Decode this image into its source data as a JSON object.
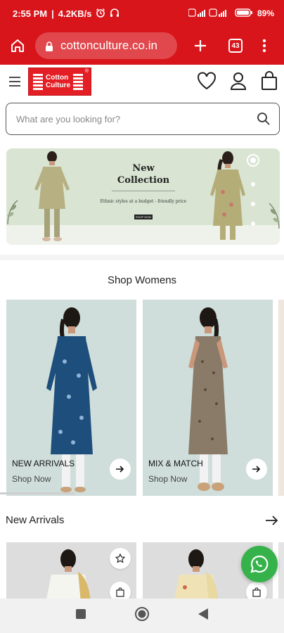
{
  "status_bar": {
    "time": "2:55 PM",
    "speed": "4.2KB/s",
    "battery": "89%",
    "icons": [
      "alarm-icon",
      "headphones-icon",
      "signal-icon",
      "wifi-icon",
      "battery-icon"
    ]
  },
  "browser": {
    "url": "cottonculture.co.in",
    "tab_count": "43",
    "icons": [
      "home-icon",
      "lock-icon",
      "new-tab-icon",
      "tab-switcher-icon",
      "more-menu-icon"
    ]
  },
  "site": {
    "logo_line1": "Cotton",
    "logo_line2": "Culture",
    "logo_mark": "®",
    "search_placeholder": "What are you looking for?",
    "icons": [
      "menu-icon",
      "wishlist-icon",
      "account-icon",
      "cart-icon",
      "search-icon"
    ]
  },
  "banner": {
    "title_line1": "New",
    "title_line2": "Collection",
    "subtitle": "Ethnic styles at a budget - friendly price",
    "button_label": "SHOP NOW",
    "slides": 4,
    "active_slide": 1
  },
  "shop_womens": {
    "title": "Shop Womens",
    "cards": [
      {
        "label": "NEW ARRIVALS",
        "sub": "Shop Now",
        "dress_color": "#1d4e7c"
      },
      {
        "label": "MIX & MATCH",
        "sub": "Shop Now",
        "dress_color": "#8a7a68"
      }
    ]
  },
  "new_arrivals": {
    "title": "New Arrivals"
  },
  "colors": {
    "brand_red": "#d8151b",
    "whatsapp_green": "#35b24a"
  }
}
